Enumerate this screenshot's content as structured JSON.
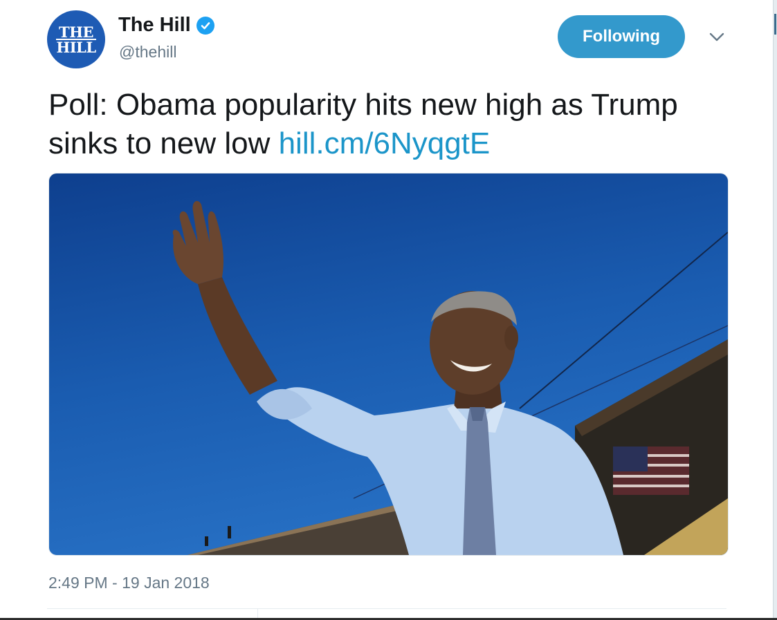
{
  "account": {
    "display_name": "The Hill",
    "handle": "@thehill",
    "avatar_line1": "THE",
    "avatar_line2": "HILL",
    "verified_icon": "verified-badge-icon"
  },
  "follow_button": {
    "label": "Following"
  },
  "menu": {
    "icon": "chevron-down-icon"
  },
  "tweet": {
    "text": "Poll: Obama popularity hits new high as Trump sinks to new low ",
    "link": "hill.cm/6NyqgtE",
    "timestamp": "2:49 PM - 19 Jan 2018"
  },
  "colors": {
    "follow_button": "#3399cc",
    "link": "#1b95c9",
    "verified": "#1da1f2",
    "avatar": "#1e5bb4"
  }
}
